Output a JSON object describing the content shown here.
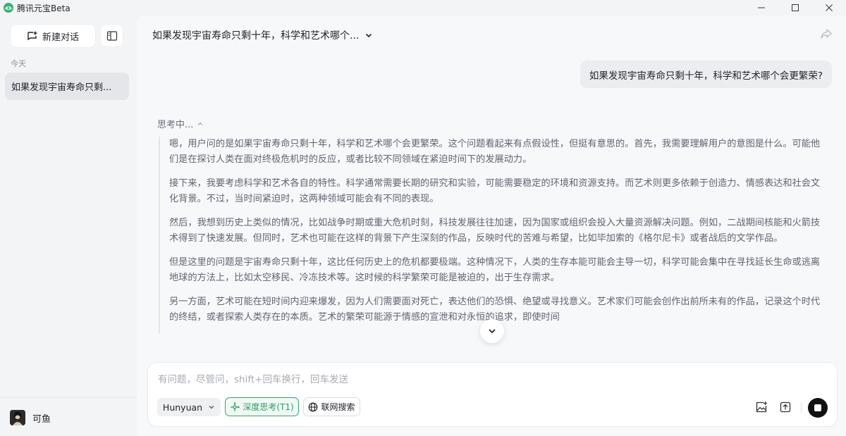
{
  "titlebar": {
    "app_title": "腾讯元宝Beta",
    "icons": [
      "yuanbao-logo-icon",
      "minimize-icon",
      "maximize-icon",
      "close-icon"
    ]
  },
  "sidebar": {
    "new_chat_label": "新建对话",
    "section_today": "今天",
    "conversations": [
      {
        "label": "如果发现宇宙寿命只剩..."
      }
    ],
    "user_name": "可鱼"
  },
  "chat": {
    "title": "如果发现宇宙寿命只剩十年，科学和艺术哪个...",
    "user_message": "如果发现宇宙寿命只剩十年，科学和艺术哪个会更繁荣?",
    "thinking_label": "思考中...",
    "thinking_paragraphs": [
      "嗯，用户问的是如果宇宙寿命只剩十年，科学和艺术哪个会更繁荣。这个问题看起来有点假设性，但挺有意思的。首先，我需要理解用户的意图是什么。可能他们是在探讨人类在面对终极危机时的反应，或者比较不同领域在紧迫时间下的发展动力。",
      "接下来，我要考虑科学和艺术各自的特性。科学通常需要长期的研究和实验，可能需要稳定的环境和资源支持。而艺术则更多依赖于创造力、情感表达和社会文化背景。不过，当时间紧迫时，这两种领域可能会有不同的表现。",
      "然后，我想到历史上类似的情况，比如战争时期或重大危机时刻，科技发展往往加速，因为国家或组织会投入大量资源解决问题。例如，二战期间核能和火箭技术得到了快速发展。但同时，艺术也可能在这样的背景下产生深刻的作品，反映时代的苦难与希望，比如毕加索的《格尔尼卡》或者战后的文学作品。",
      "但是这里的问题是宇宙寿命只剩十年，这比任何历史上的危机都要极端。这种情况下，人类的生存本能可能会主导一切，科学可能会集中在寻找延长生命或逃离地球的方法上，比如太空移民、冷冻技术等。这时候的科学繁荣可能是被迫的，出于生存需求。",
      "另一方面，艺术可能在短时间内迎来爆发，因为人们需要面对死亡，表达他们的恐惧、绝望或寻找意义。艺术家们可能会创作出前所未有的作品，记录这个时代的终结，或者探索人类存在的本质。艺术的繁荣可能源于情感的宣泄和对永恒的追求，即使时间"
    ]
  },
  "composer": {
    "placeholder": "有问题，尽管问，shift+回车换行，回车发送",
    "model": "Hunyuan",
    "deep_think_label": "深度思考(T1)",
    "web_search_label": "联网搜索"
  },
  "colors": {
    "accent_green": "#2f9a63",
    "stop_button": "#111111"
  }
}
